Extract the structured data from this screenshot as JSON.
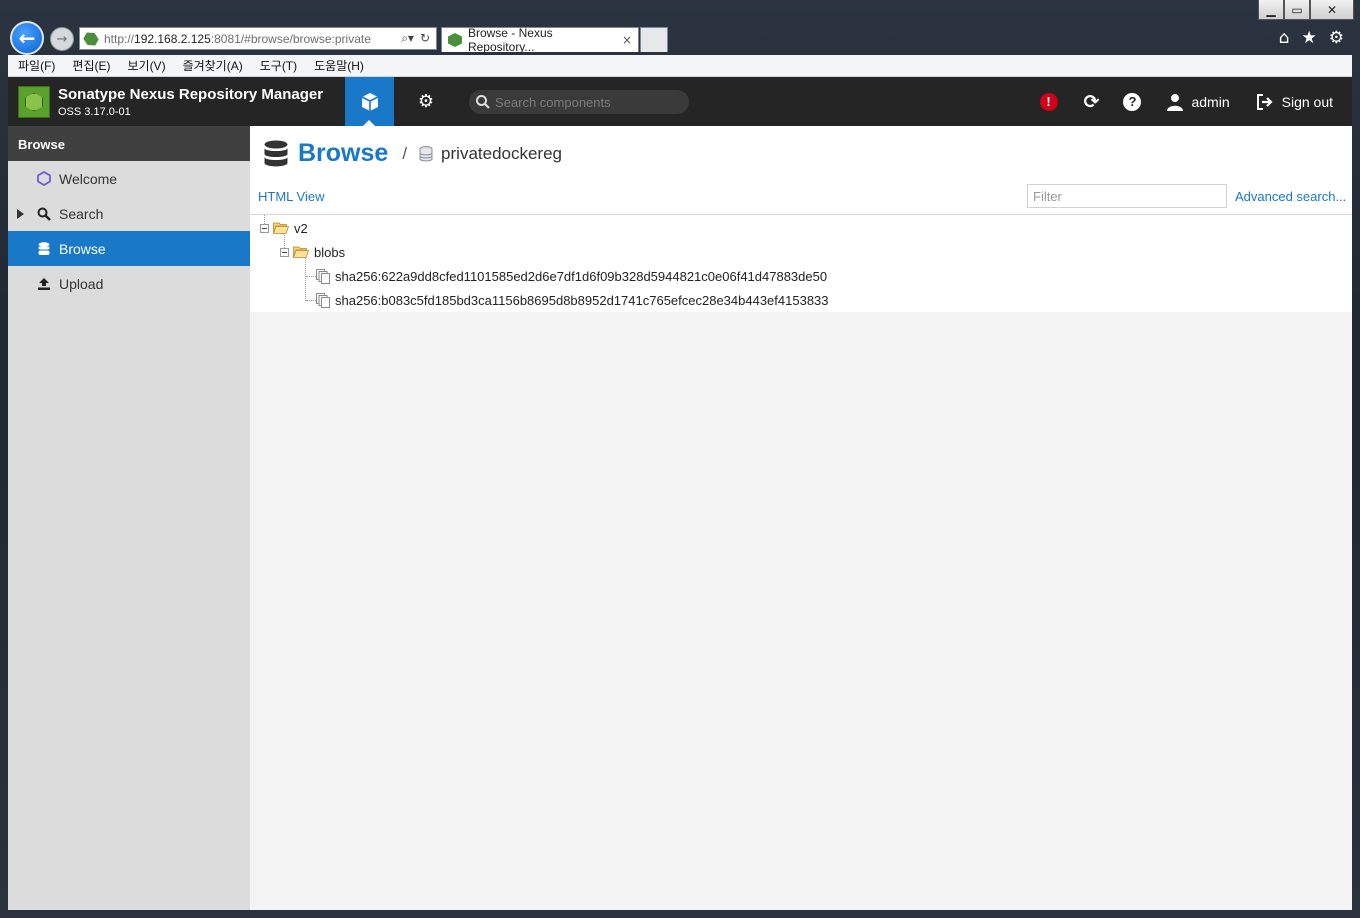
{
  "browser": {
    "url_prefix": "http://",
    "url_host": "192.168.2.125",
    "url_rest": ":8081/#browse/browse:private",
    "tab_title": "Browse - Nexus Repository...",
    "tab_close": "×",
    "window_controls": [
      "minimize",
      "maximize",
      "close"
    ]
  },
  "menubar": {
    "items": [
      "파일(F)",
      "편집(E)",
      "보기(V)",
      "즐겨찾기(A)",
      "도구(T)",
      "도움말(H)"
    ]
  },
  "header": {
    "product_name": "Sonatype Nexus Repository Manager",
    "version": "OSS 3.17.0-01",
    "search_placeholder": "Search components",
    "username": "admin",
    "signout_label": "Sign out",
    "accent_color": "#1a78c9",
    "alert_color": "#d0021b"
  },
  "sidebar": {
    "header": "Browse",
    "items": [
      {
        "label": "Welcome",
        "icon": "hexagon-icon"
      },
      {
        "label": "Search",
        "icon": "magnifier-icon"
      },
      {
        "label": "Browse",
        "icon": "database-icon"
      },
      {
        "label": "Upload",
        "icon": "upload-icon"
      }
    ]
  },
  "main": {
    "title": "Browse",
    "breadcrumb_separator": "/",
    "repository": "privatedockereg",
    "html_view_label": "HTML View",
    "filter_placeholder": "Filter",
    "advanced_search_label": "Advanced search...",
    "tree": {
      "root": "v2",
      "folder": "blobs",
      "files": [
        "sha256:622a9dd8cfed1101585ed2d6e7df1d6f09b328d5944821c0e06f41d47883de50",
        "sha256:b083c5fd185bd3ca1156b8695d8b8952d1741c765efcec28e34b443ef4153833"
      ]
    }
  }
}
